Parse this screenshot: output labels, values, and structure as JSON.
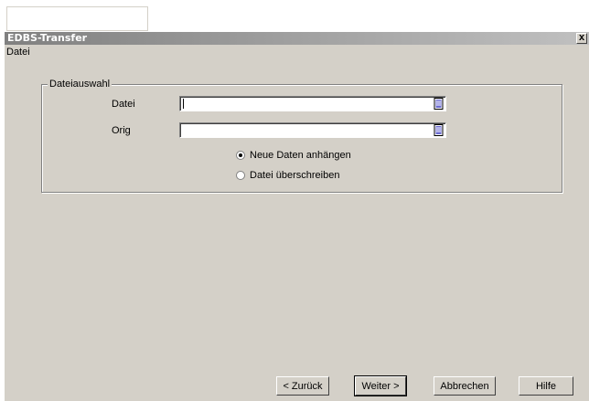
{
  "window": {
    "title": "EDBS-Transfer",
    "close_glyph": "✕"
  },
  "menu": {
    "items": [
      {
        "label": "Datei"
      }
    ]
  },
  "group": {
    "legend": "Dateiauswahl",
    "fields": [
      {
        "label": "Datei",
        "value": "",
        "icon": "browse-file-icon"
      },
      {
        "label": "Orig",
        "value": "",
        "icon": "browse-file-icon"
      }
    ],
    "options": [
      {
        "label": "Neue Daten anhängen",
        "selected": true
      },
      {
        "label": "Datei überschreiben",
        "selected": false
      }
    ]
  },
  "buttons": {
    "back": "< Zurück",
    "next": "Weiter >",
    "cancel": "Abbrechen",
    "help": "Hilfe"
  },
  "colors": {
    "face": "#d4d0c8",
    "title_gradient_start": "#808080",
    "title_gradient_end": "#c0c0c0"
  }
}
